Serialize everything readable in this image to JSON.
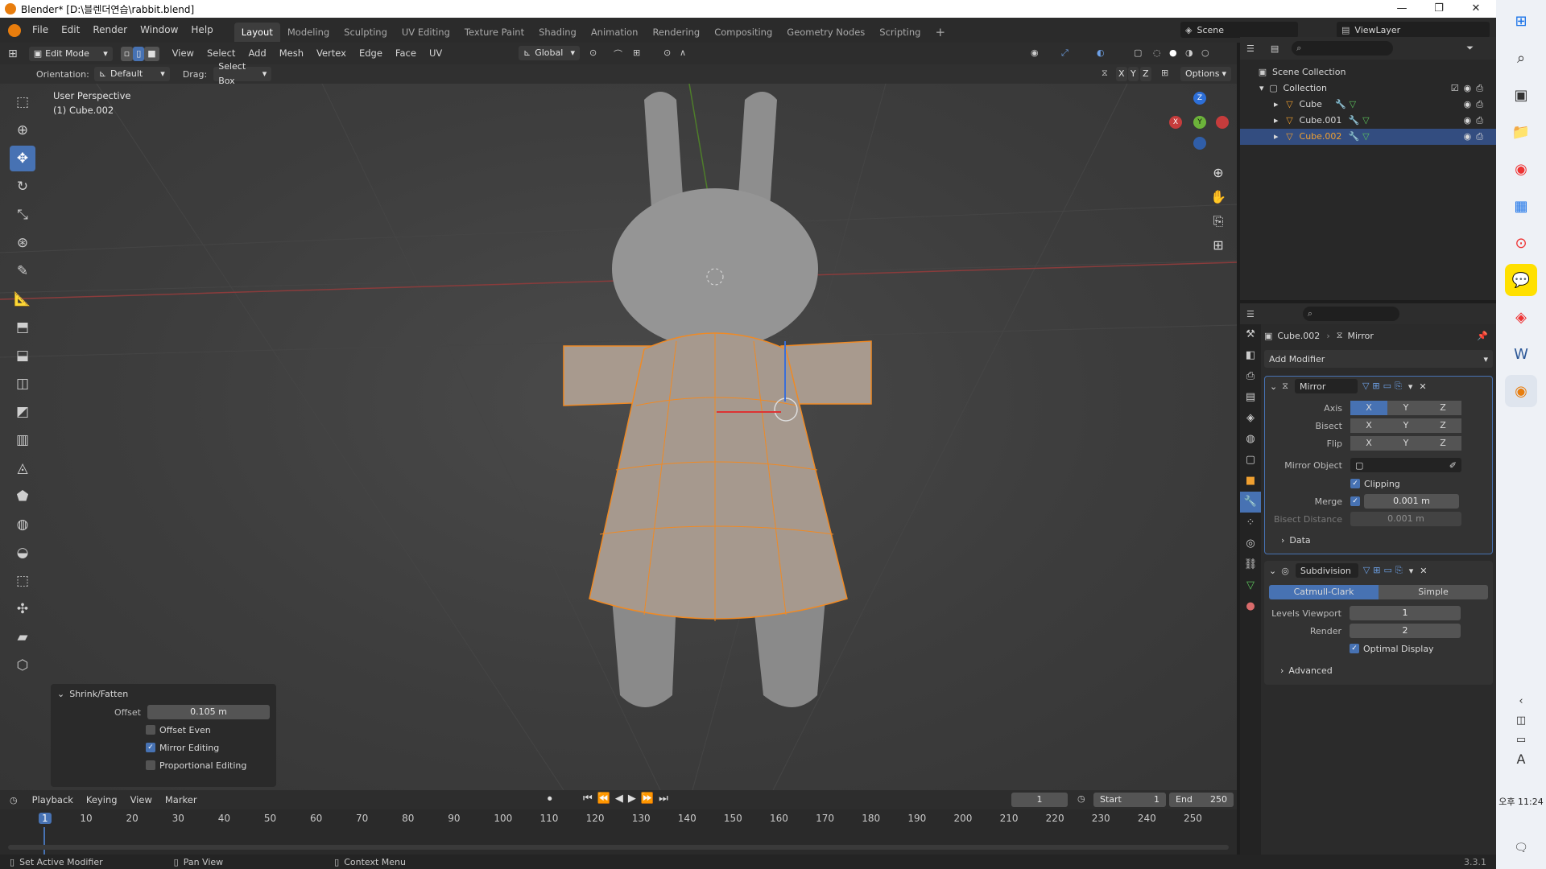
{
  "titlebar": {
    "title": "Blender* [D:\\블렌더연습\\rabbit.blend]",
    "minimize": "—",
    "maximize": "❐",
    "close": "✕"
  },
  "menus": [
    "File",
    "Edit",
    "Render",
    "Window",
    "Help"
  ],
  "workspaces": [
    "Layout",
    "Modeling",
    "Sculpting",
    "UV Editing",
    "Texture Paint",
    "Shading",
    "Animation",
    "Rendering",
    "Compositing",
    "Geometry Nodes",
    "Scripting"
  ],
  "scene": {
    "label": "Scene",
    "viewlayer": "ViewLayer"
  },
  "vpheader": {
    "mode": "Edit Mode",
    "menus": [
      "View",
      "Select",
      "Add",
      "Mesh",
      "Vertex",
      "Edge",
      "Face",
      "UV"
    ],
    "transform": "Global",
    "orientation_label": "Orientation:",
    "orientation_value": "Default",
    "drag_label": "Drag:",
    "drag_value": "Select Box",
    "options": "Options",
    "axes": [
      "X",
      "Y",
      "Z"
    ]
  },
  "viewport": {
    "perspective": "User Perspective",
    "object": "(1) Cube.002",
    "gizmo": {
      "x": "X",
      "y": "Y",
      "z": "Z"
    }
  },
  "operator": {
    "title": "Shrink/Fatten",
    "offset_label": "Offset",
    "offset_value": "0.105 m",
    "offset_even": "Offset Even",
    "mirror_editing": "Mirror Editing",
    "proportional": "Proportional Editing",
    "checks": {
      "offset_even": false,
      "mirror_editing": true,
      "proportional": false
    }
  },
  "outliner": {
    "root": "Scene Collection",
    "collection": "Collection",
    "items": [
      "Cube",
      "Cube.001",
      "Cube.002"
    ],
    "selected": "Cube.002"
  },
  "properties": {
    "breadcrumb_object": "Cube.002",
    "breadcrumb_modifier": "Mirror",
    "add_modifier": "Add Modifier",
    "mirror": {
      "name": "Mirror",
      "axis_label": "Axis",
      "bisect_label": "Bisect",
      "flip_label": "Flip",
      "xyz": [
        "X",
        "Y",
        "Z"
      ],
      "mirror_object": "Mirror Object",
      "clipping": "Clipping",
      "merge_label": "Merge",
      "merge_value": "0.001 m",
      "bisect_distance_label": "Bisect Distance",
      "bisect_distance_value": "0.001 m",
      "data": "Data"
    },
    "subdivision": {
      "name": "Subdivision",
      "catmull": "Catmull-Clark",
      "simple": "Simple",
      "levels_label": "Levels Viewport",
      "levels_value": "1",
      "render_label": "Render",
      "render_value": "2",
      "optimal": "Optimal Display",
      "advanced": "Advanced"
    }
  },
  "timeline": {
    "menus": [
      "Playback",
      "Keying",
      "View",
      "Marker"
    ],
    "current_frame": "1",
    "start_label": "Start",
    "start_value": "1",
    "end_label": "End",
    "end_value": "250",
    "ticks": [
      "1",
      "10",
      "20",
      "30",
      "40",
      "50",
      "60",
      "70",
      "80",
      "90",
      "100",
      "110",
      "120",
      "130",
      "140",
      "150",
      "160",
      "170",
      "180",
      "190",
      "200",
      "210",
      "220",
      "230",
      "240",
      "250"
    ]
  },
  "status": {
    "left": "Set Active Modifier",
    "middle": "Pan View",
    "right": "Context Menu",
    "version": "3.3.1"
  },
  "taskbar": {
    "time": "오후 11:24",
    "lang": "A"
  },
  "colors": {
    "accent": "#4772b3",
    "selection_orange": "#f08a24",
    "mesh": "#9a9a9a"
  }
}
